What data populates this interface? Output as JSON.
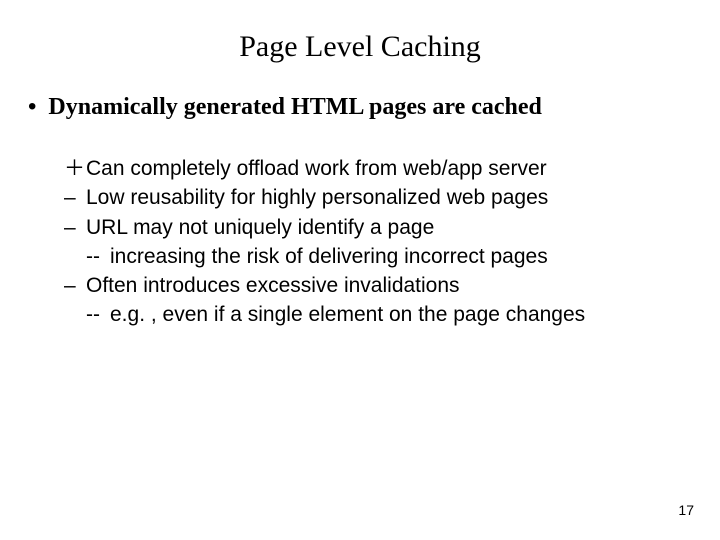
{
  "title": "Page Level Caching",
  "main_bullet": {
    "dot": "•",
    "text": "Dynamically generated HTML pages are cached"
  },
  "sub": {
    "plus": "＋",
    "minus": "–",
    "dash": "--",
    "items": {
      "a": "Can completely offload work from web/app server",
      "b": "Low reusability for highly personalized web pages",
      "c": "URL may not uniquely identify a page",
      "c_sub": "increasing the risk of delivering incorrect pages",
      "d": "Often introduces excessive invalidations",
      "d_sub": "e.g. , even if a single element on the page changes"
    }
  },
  "page_number": "17"
}
